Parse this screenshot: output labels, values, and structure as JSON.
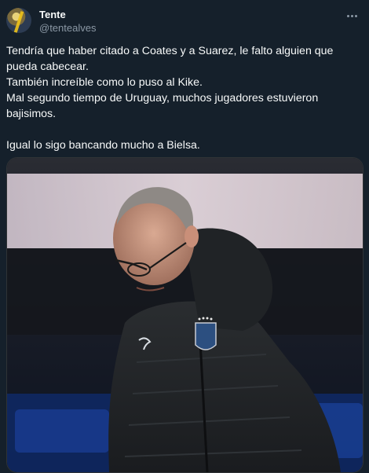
{
  "author": {
    "display_name": "Tente",
    "handle": "@tentealves",
    "avatar_icon": "user-avatar"
  },
  "more_icon": "more-horizontal-icon",
  "tweet": {
    "lines": [
      "Tendría que haber citado a Coates y a Suarez, le falto alguien que pueda cabecear.\nTambién increíble como lo puso al Kike.\nMal segundo tiempo de Uruguay, muchos jugadores estuvieron bajisimos.",
      "Igual lo sigo bancando mucho a Bielsa."
    ]
  },
  "media": {
    "description_icon": "photo"
  },
  "colors": {
    "background": "#15202b",
    "text": "#f7f9f9",
    "secondary": "#8b98a5"
  }
}
